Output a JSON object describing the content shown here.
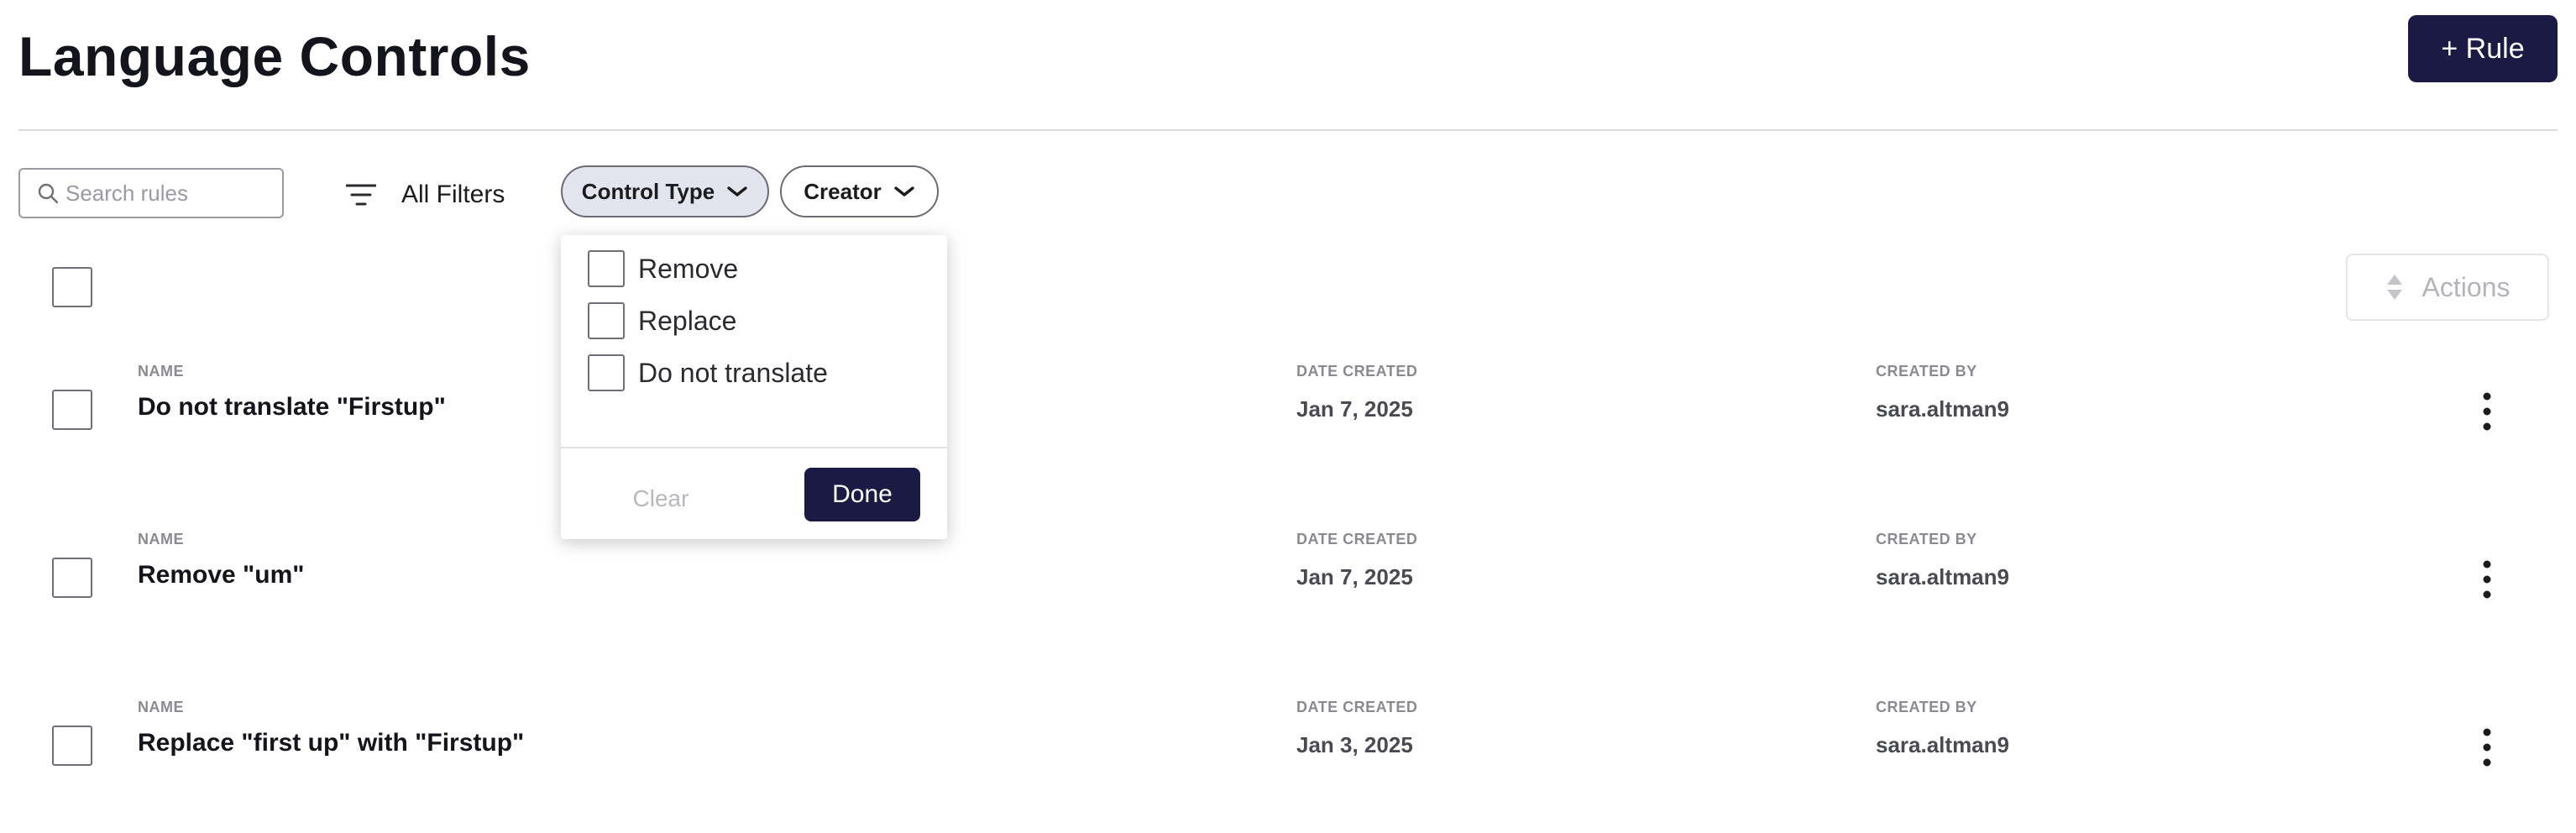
{
  "header": {
    "title": "Language Controls",
    "add_rule_label": "+ Rule"
  },
  "toolbar": {
    "search_placeholder": "Search rules",
    "all_filters_label": "All Filters",
    "chips": [
      {
        "label": "Control Type",
        "active": true
      },
      {
        "label": "Creator",
        "active": false
      }
    ]
  },
  "dropdown": {
    "options": [
      {
        "label": "Remove",
        "checked": false
      },
      {
        "label": "Replace",
        "checked": false
      },
      {
        "label": "Do not translate",
        "checked": false
      }
    ],
    "clear_label": "Clear",
    "done_label": "Done"
  },
  "list": {
    "actions_label": "Actions",
    "column_labels": {
      "name": "NAME",
      "date": "DATE CREATED",
      "creator": "CREATED BY"
    },
    "rows": [
      {
        "name": "Do not translate \"Firstup\"",
        "date": "Jan 7, 2025",
        "creator": "sara.altman9"
      },
      {
        "name": "Remove \"um\"",
        "date": "Jan 7, 2025",
        "creator": "sara.altman9"
      },
      {
        "name": "Replace \"first up\" with \"Firstup\"",
        "date": "Jan 3, 2025",
        "creator": "sara.altman9"
      }
    ]
  },
  "colors": {
    "primary": "#1a1a44",
    "active_chip_bg": "#e4e4ee",
    "divider": "#dddde0"
  },
  "icons": {
    "search": "search-icon",
    "filter": "filter-icon",
    "chevron": "chevron-down-icon",
    "sort": "sort-icon",
    "kebab": "kebab-menu-icon"
  }
}
